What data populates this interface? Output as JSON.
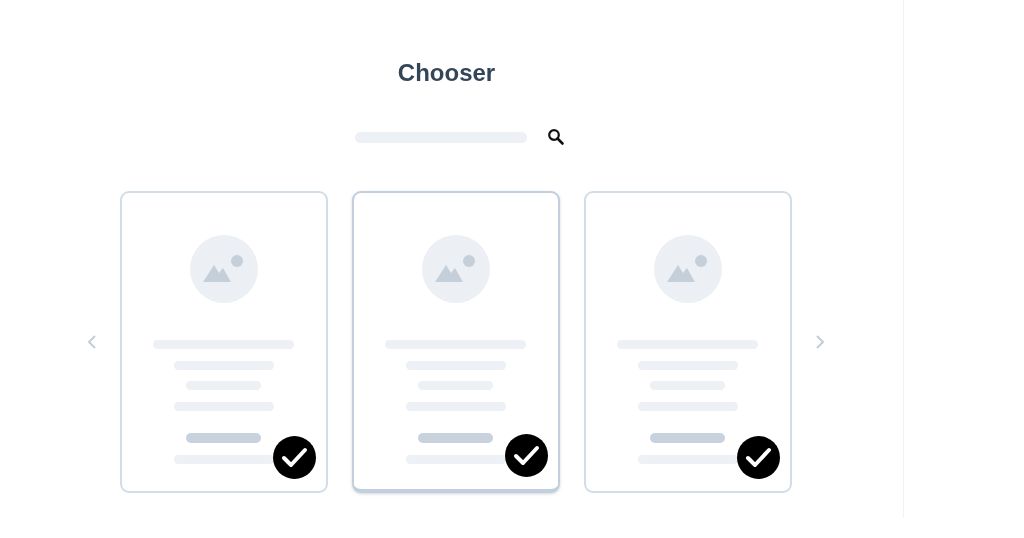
{
  "title": "Chooser",
  "cards": [
    {
      "selected": false,
      "checked": true
    },
    {
      "selected": true,
      "checked": true
    },
    {
      "selected": false,
      "checked": true
    }
  ]
}
